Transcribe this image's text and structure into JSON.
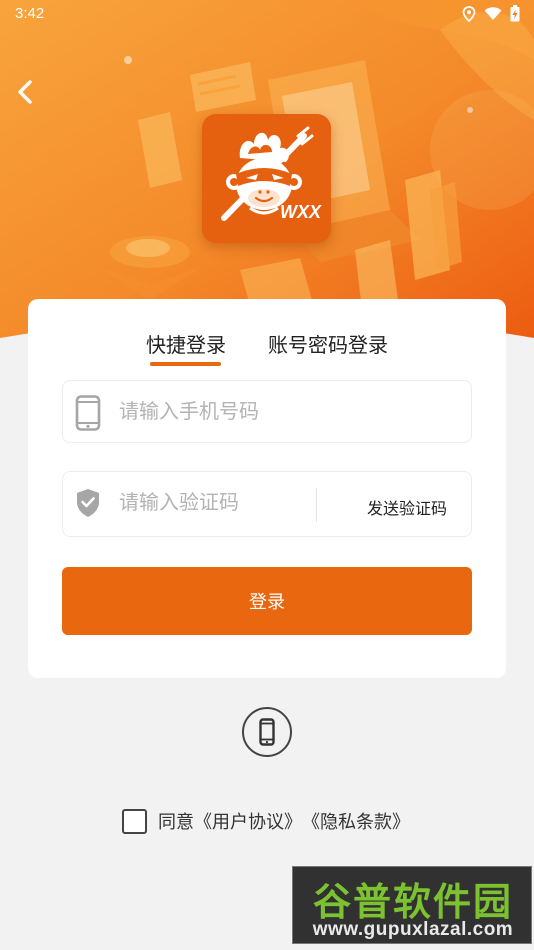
{
  "status_bar": {
    "time": "3:42",
    "icons": [
      "location-icon",
      "wifi-icon",
      "battery-charging-icon"
    ]
  },
  "header": {
    "back_icon": "chevron-left-icon",
    "logo_text": "WXX"
  },
  "tabs": [
    {
      "label": "快捷登录",
      "active": true
    },
    {
      "label": "账号密码登录",
      "active": false
    }
  ],
  "form": {
    "phone_placeholder": "请输入手机号码",
    "phone_value": "",
    "code_placeholder": "请输入验证码",
    "code_value": "",
    "send_code_label": "发送验证码",
    "login_label": "登录"
  },
  "footer": {
    "alt_login_icon": "mobile-phone-icon",
    "agree_prefix": "同意",
    "user_agreement": "《用户协议》",
    "privacy_terms": "《隐私条款》",
    "agreed": false
  },
  "watermark": {
    "title": "谷普软件园",
    "url": "www.gupuxlazal.com"
  },
  "colors": {
    "accent": "#e8670f",
    "hero_gradient_start": "#f7a43a",
    "hero_gradient_end": "#ed5f12",
    "page_background": "#f2f2f2"
  }
}
